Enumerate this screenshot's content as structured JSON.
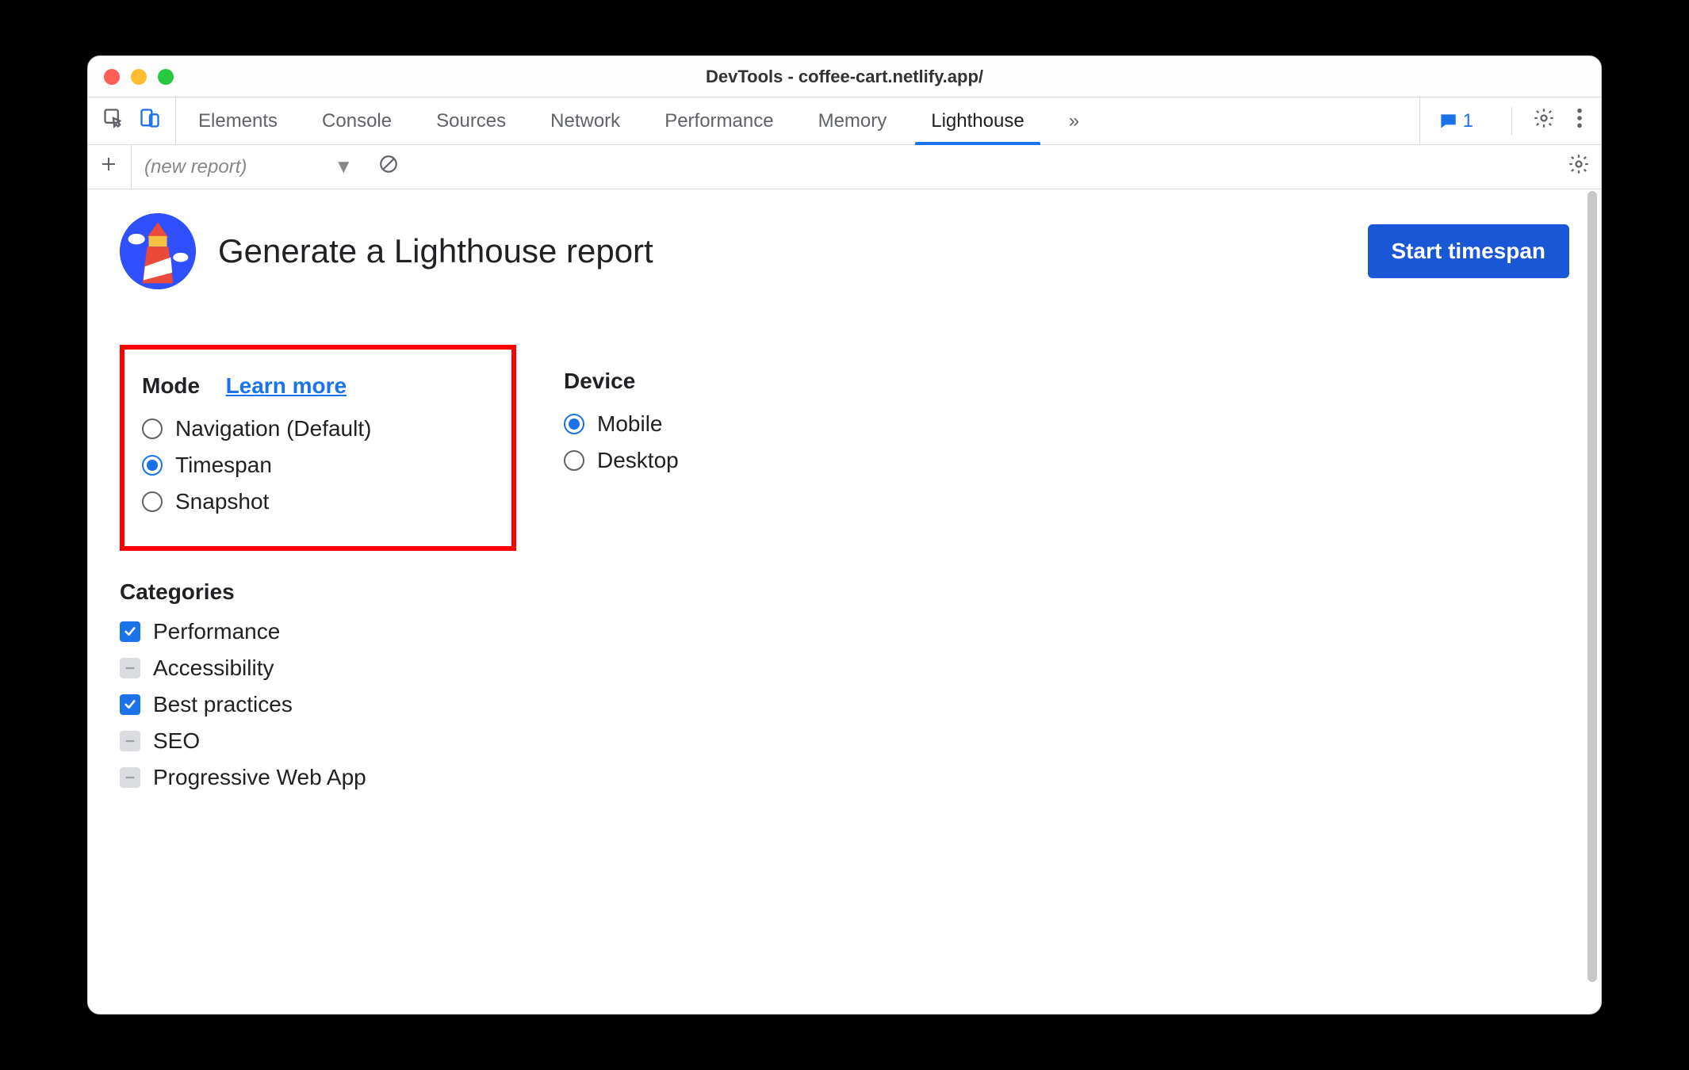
{
  "window": {
    "title": "DevTools - coffee-cart.netlify.app/"
  },
  "tabs": {
    "items": [
      "Elements",
      "Console",
      "Sources",
      "Network",
      "Performance",
      "Memory",
      "Lighthouse"
    ],
    "active": "Lighthouse",
    "overflow_glyph": "»",
    "message_count": "1"
  },
  "subbar": {
    "dropdown_label": "(new report)"
  },
  "lighthouse": {
    "title": "Generate a Lighthouse report",
    "start_button": "Start timespan",
    "mode": {
      "label": "Mode",
      "learn_more": "Learn more",
      "options": [
        {
          "label": "Navigation (Default)",
          "checked": false
        },
        {
          "label": "Timespan",
          "checked": true
        },
        {
          "label": "Snapshot",
          "checked": false
        }
      ]
    },
    "device": {
      "label": "Device",
      "options": [
        {
          "label": "Mobile",
          "checked": true
        },
        {
          "label": "Desktop",
          "checked": false
        }
      ]
    },
    "categories": {
      "label": "Categories",
      "options": [
        {
          "label": "Performance",
          "state": "checked"
        },
        {
          "label": "Accessibility",
          "state": "indeterminate"
        },
        {
          "label": "Best practices",
          "state": "checked"
        },
        {
          "label": "SEO",
          "state": "indeterminate"
        },
        {
          "label": "Progressive Web App",
          "state": "indeterminate"
        }
      ]
    }
  }
}
